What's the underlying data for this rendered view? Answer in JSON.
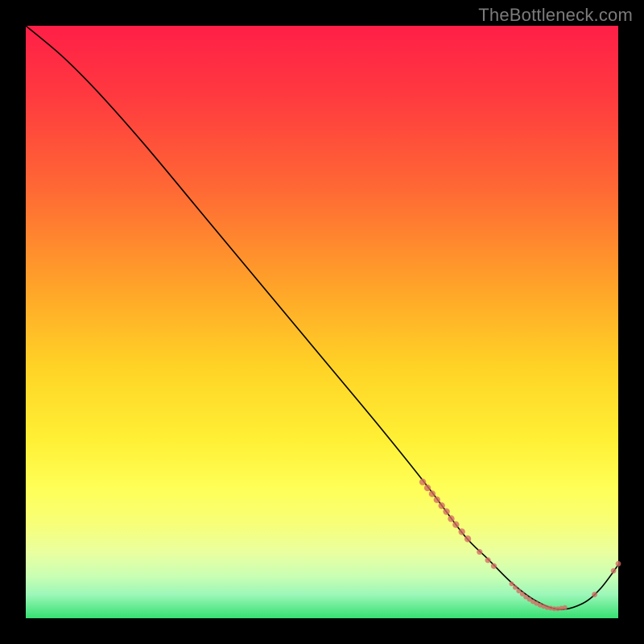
{
  "watermark": "TheBottleneck.com",
  "chart_data": {
    "type": "line",
    "title": "",
    "xlabel": "",
    "ylabel": "",
    "xlim": [
      0,
      100
    ],
    "ylim": [
      0,
      100
    ],
    "grid": false,
    "legend": false,
    "background": "rainbow-vertical",
    "series": [
      {
        "name": "curve",
        "x": [
          0,
          6,
          12,
          20,
          30,
          40,
          50,
          60,
          68,
          74,
          78,
          82,
          86,
          90,
          94,
          97,
          100
        ],
        "y": [
          100,
          95,
          89,
          80,
          68,
          56,
          44,
          32,
          22,
          14,
          10,
          6,
          3,
          1.5,
          2.5,
          5,
          9
        ]
      }
    ],
    "markers": [
      {
        "name": "cluster-upper",
        "shape": "circle",
        "color": "#d46b63",
        "points": [
          {
            "x": 67.0,
            "y": 23.0,
            "r": 4.2
          },
          {
            "x": 67.8,
            "y": 22.0,
            "r": 4.2
          },
          {
            "x": 68.6,
            "y": 21.0,
            "r": 4.2
          },
          {
            "x": 69.4,
            "y": 20.0,
            "r": 4.2
          },
          {
            "x": 70.2,
            "y": 19.0,
            "r": 4.2
          },
          {
            "x": 71.0,
            "y": 18.0,
            "r": 4.2
          },
          {
            "x": 71.8,
            "y": 16.8,
            "r": 4.2
          },
          {
            "x": 72.6,
            "y": 15.8,
            "r": 4.2
          },
          {
            "x": 73.6,
            "y": 14.6,
            "r": 4.2
          },
          {
            "x": 74.6,
            "y": 13.4,
            "r": 4.2
          },
          {
            "x": 76.6,
            "y": 11.2,
            "r": 3.6
          },
          {
            "x": 78.0,
            "y": 9.8,
            "r": 3.6
          },
          {
            "x": 79.0,
            "y": 8.8,
            "r": 3.6
          }
        ]
      },
      {
        "name": "cluster-bottom",
        "shape": "circle",
        "color": "#d46b63",
        "points": [
          {
            "x": 82.0,
            "y": 5.8,
            "r": 3.0
          },
          {
            "x": 82.6,
            "y": 5.2,
            "r": 3.0
          },
          {
            "x": 83.2,
            "y": 4.6,
            "r": 3.0
          },
          {
            "x": 83.8,
            "y": 4.1,
            "r": 3.0
          },
          {
            "x": 84.4,
            "y": 3.6,
            "r": 3.0
          },
          {
            "x": 85.0,
            "y": 3.2,
            "r": 3.0
          },
          {
            "x": 85.6,
            "y": 2.8,
            "r": 3.0
          },
          {
            "x": 86.2,
            "y": 2.5,
            "r": 3.0
          },
          {
            "x": 86.8,
            "y": 2.2,
            "r": 3.0
          },
          {
            "x": 87.4,
            "y": 2.0,
            "r": 3.0
          },
          {
            "x": 88.0,
            "y": 1.8,
            "r": 3.0
          },
          {
            "x": 88.6,
            "y": 1.7,
            "r": 3.0
          },
          {
            "x": 89.2,
            "y": 1.6,
            "r": 3.0
          },
          {
            "x": 89.8,
            "y": 1.6,
            "r": 3.0
          },
          {
            "x": 90.4,
            "y": 1.7,
            "r": 3.0
          },
          {
            "x": 91.0,
            "y": 1.8,
            "r": 3.0
          }
        ]
      },
      {
        "name": "tail",
        "shape": "circle",
        "color": "#d46b63",
        "points": [
          {
            "x": 96.0,
            "y": 4.0,
            "r": 3.4
          },
          {
            "x": 99.2,
            "y": 8.0,
            "r": 3.4
          },
          {
            "x": 100.0,
            "y": 9.2,
            "r": 3.4
          }
        ]
      }
    ]
  }
}
